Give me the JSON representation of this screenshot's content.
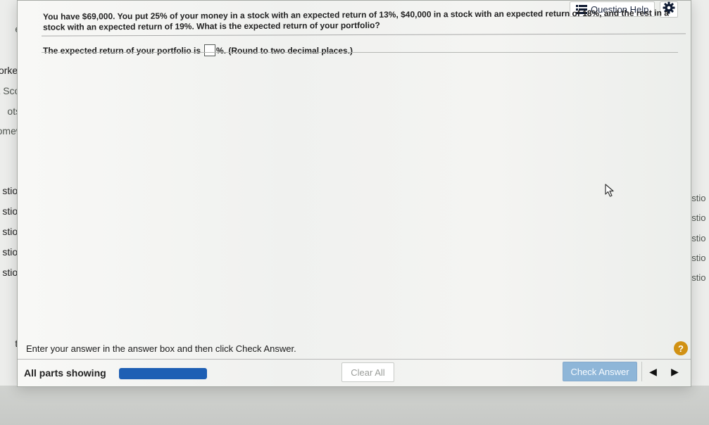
{
  "background": {
    "left_peek": [
      "e:",
      "orked",
      "nt Scor",
      "ots:",
      "omew",
      "stion",
      "stion",
      "stion",
      "stion",
      "stion",
      "to"
    ],
    "right_peek": [
      "estio",
      "estio",
      "estio",
      "estio",
      "estio"
    ]
  },
  "toolbar": {
    "question_help_label": "Question Help",
    "question_help_icon": "list-icon",
    "settings_icon": "gear-icon"
  },
  "question": {
    "text": "You have $69,000. You put 25% of your money in a stock with an expected return of 13%, $40,000 in a stock with an expected return of 18%, and the rest in a stock with an expected return of 19%. What is the expected return of your portfolio?",
    "answer_prefix": "The expected return of your portfolio is",
    "answer_value": "",
    "answer_suffix": "%. (Round to two decimal places.)"
  },
  "footer": {
    "instruction": "Enter your answer in the answer box and then click Check Answer.",
    "help_symbol": "?",
    "parts_label": "All parts showing",
    "progress": 1,
    "clear_label": "Clear All",
    "check_label": "Check Answer",
    "prev_symbol": "◀",
    "next_symbol": "▶"
  },
  "colors": {
    "accent_blue": "#1e5fb4",
    "check_button": "#8eb6d8",
    "help_circle": "#d19113"
  }
}
